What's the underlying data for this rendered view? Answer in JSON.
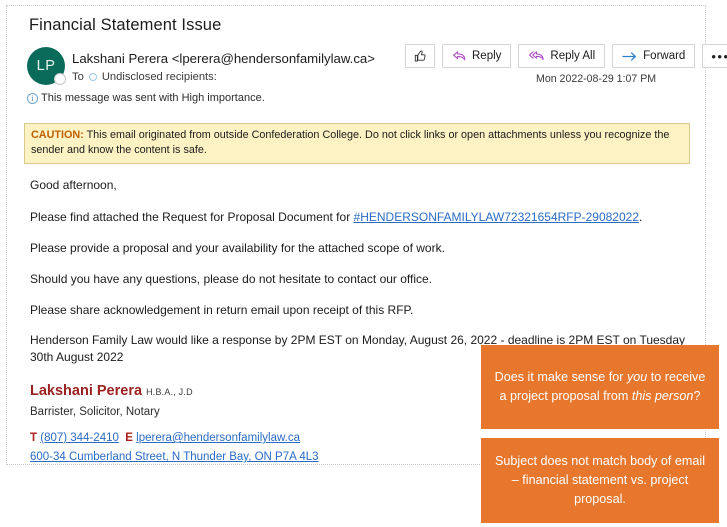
{
  "email": {
    "subject": "Financial Statement Issue",
    "avatar_initials": "LP",
    "sender": "Lakshani Perera <lperera@hendersonfamilylaw.ca>",
    "to_label": "To",
    "to_value": "Undisclosed recipients:",
    "importance_notice": "This message was sent with High importance.",
    "timestamp": "Mon 2022-08-29 1:07 PM",
    "actions": {
      "like_label": "",
      "reply_label": "Reply",
      "reply_all_label": "Reply All",
      "forward_label": "Forward",
      "more_label": "•••"
    },
    "caution": {
      "prefix": "CAUTION:",
      "text": " This email originated from outside Confederation College. Do not click links or open attachments unless you recognize the sender and know the content is safe."
    },
    "body": {
      "greeting": "Good afternoon,",
      "rfp_before": "Please find attached the Request for Proposal Document for ",
      "rfp_link": "#HENDERSONFAMILYLAW72321654RFP-29082022",
      "rfp_after": ".",
      "proposal": "Please provide a proposal and your availability for the attached scope of work.",
      "questions": "Should you have any questions, please do not hesitate to contact our office.",
      "acknowledgement": "Please share acknowledgement in return email upon receipt of this RFP.",
      "deadline": "Henderson Family Law would like a response by 2PM EST on Monday, August 26, 2022 - deadline is 2PM EST on  Tuesday 30th August 2022"
    },
    "signature": {
      "name": "Lakshani Perera",
      "credentials": "H.B.A., J.D",
      "title": "Barrister, Solicitor, Notary",
      "phone_label": "T",
      "phone": "(807) 344-2410",
      "email_label": "E",
      "email": "lperera@hendersonfamilylaw.ca",
      "address": "600-34 Cumberland Street, N Thunder Bay, ON P7A 4L3"
    }
  },
  "annotations": [
    {
      "id": "recipient-mismatch",
      "part1": "Does it make sense for ",
      "em1": "you",
      "part2": " to receive a project proposal from ",
      "em2": "this person",
      "part3": "?"
    },
    {
      "id": "subject-mismatch",
      "text": "Subject does not match body of email – financial statement vs. project proposal."
    }
  ],
  "colors": {
    "accent_orange": "#e8772e",
    "avatar_teal": "#0a6b5b",
    "caution_bg": "#fdf2c4",
    "caution_text": "#c06000",
    "link_blue": "#2a6cc4",
    "signature_red": "#9c2121",
    "reply_purple": "#b14fc9",
    "forward_blue": "#2a7fd4"
  }
}
